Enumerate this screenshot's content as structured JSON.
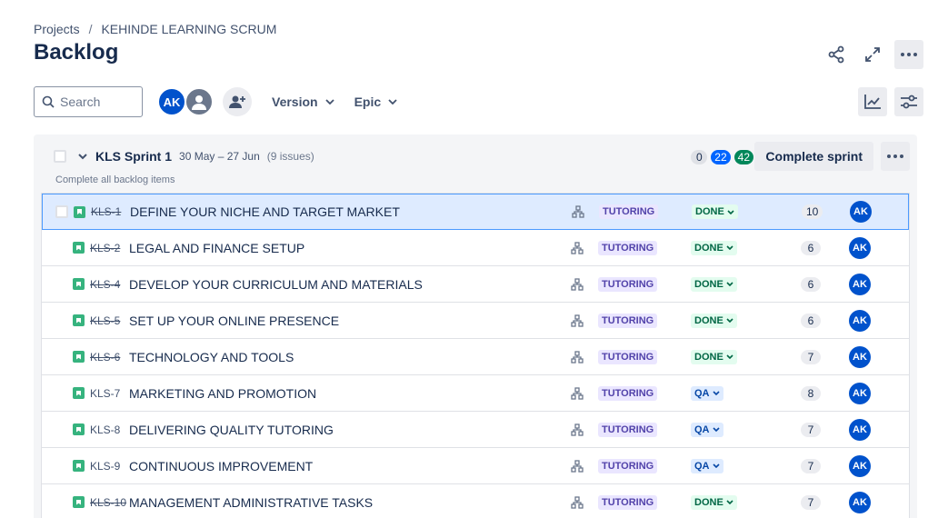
{
  "breadcrumb": {
    "projects": "Projects",
    "separator": "/",
    "project": "KEHINDE LEARNING SCRUM"
  },
  "page_title": "Backlog",
  "search": {
    "placeholder": "Search",
    "value": ""
  },
  "avatars": [
    {
      "initials": "AK",
      "color": "#0052cc"
    },
    {
      "initials": "",
      "color": "#6b778c"
    }
  ],
  "filters": {
    "version": "Version",
    "epic": "Epic"
  },
  "sprint": {
    "name": "KLS Sprint 1",
    "dates": "30 May – 27 Jun",
    "issue_count": "(9 issues)",
    "counts": {
      "todo": "0",
      "in_progress": "22",
      "done": "42"
    },
    "complete_button": "Complete sprint",
    "complete_all": "Complete all backlog items"
  },
  "issues": [
    {
      "key": "KLS-1",
      "summary": "DEFINE YOUR NICHE AND TARGET MARKET",
      "epic": "TUTORING",
      "status": "DONE",
      "status_type": "done",
      "points": "10",
      "assignee": "AK",
      "key_done": true,
      "selected": true
    },
    {
      "key": "KLS-2",
      "summary": "LEGAL AND FINANCE SETUP",
      "epic": "TUTORING",
      "status": "DONE",
      "status_type": "done",
      "points": "6",
      "assignee": "AK",
      "key_done": true
    },
    {
      "key": "KLS-4",
      "summary": "DEVELOP YOUR CURRICULUM AND MATERIALS",
      "epic": "TUTORING",
      "status": "DONE",
      "status_type": "done",
      "points": "6",
      "assignee": "AK",
      "key_done": true
    },
    {
      "key": "KLS-5",
      "summary": "SET UP YOUR ONLINE PRESENCE",
      "epic": "TUTORING",
      "status": "DONE",
      "status_type": "done",
      "points": "6",
      "assignee": "AK",
      "key_done": true
    },
    {
      "key": "KLS-6",
      "summary": "TECHNOLOGY AND TOOLS",
      "epic": "TUTORING",
      "status": "DONE",
      "status_type": "done",
      "points": "7",
      "assignee": "AK",
      "key_done": true
    },
    {
      "key": "KLS-7",
      "summary": "MARKETING AND PROMOTION",
      "epic": "TUTORING",
      "status": "QA",
      "status_type": "qa",
      "points": "8",
      "assignee": "AK",
      "key_done": false
    },
    {
      "key": "KLS-8",
      "summary": "DELIVERING QUALITY TUTORING",
      "epic": "TUTORING",
      "status": "QA",
      "status_type": "qa",
      "points": "7",
      "assignee": "AK",
      "key_done": false
    },
    {
      "key": "KLS-9",
      "summary": "CONTINUOUS IMPROVEMENT",
      "epic": "TUTORING",
      "status": "QA",
      "status_type": "qa",
      "points": "7",
      "assignee": "AK",
      "key_done": false
    },
    {
      "key": "KLS-10",
      "summary": "MANAGEMENT ADMINISTRATIVE TASKS",
      "epic": "TUTORING",
      "status": "DONE",
      "status_type": "done",
      "points": "7",
      "assignee": "AK",
      "key_done": true
    }
  ]
}
